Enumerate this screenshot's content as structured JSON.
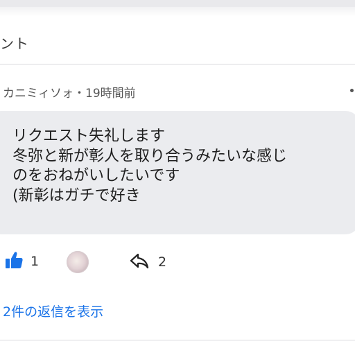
{
  "header": {
    "title": "ント"
  },
  "comment": {
    "author": "カニミィソォ",
    "separator": "・",
    "timestamp": "19時間前",
    "lines": [
      "リクエスト失礼します",
      "冬弥と新が彰人を取り合うみたいな感じ",
      "のをおねがいしたいです",
      "(新彰はガチで好き"
    ],
    "likes": "1",
    "replies_count": "2",
    "view_replies_label": "2件の返信を表示"
  },
  "colors": {
    "accent": "#1a73e8",
    "bubble": "#ebecef",
    "like_icon": "#1a73e8"
  },
  "icons": {
    "like": "thumbs-up-icon",
    "share": "reply-arrow-icon",
    "more": "more-dots-icon"
  }
}
